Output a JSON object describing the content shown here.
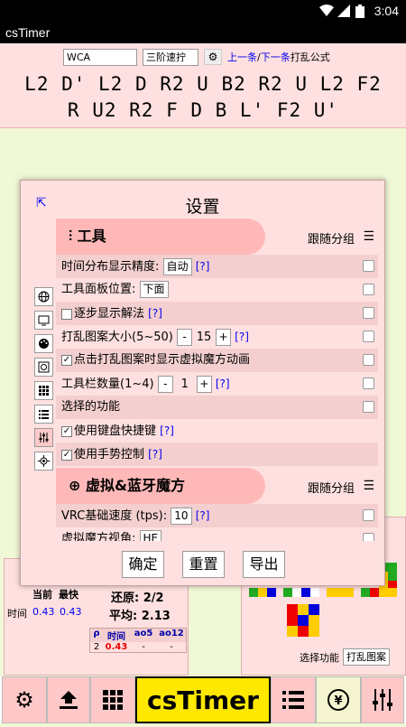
{
  "status_bar": {
    "time": "3:04"
  },
  "app_title": "csTimer",
  "scramble_bar": {
    "event_type": "WCA",
    "event": "三阶速拧",
    "prev_link": "上一条",
    "separator": "/",
    "next_link": "下一条",
    "scramble_label": "打乱公式",
    "scramble_line1": "L2 D' L2 D R2 U B2 R2 U L2 F2",
    "scramble_line2": "R U2 R2 F D B L' F2 U'"
  },
  "dialog": {
    "title": "设置",
    "sections": [
      {
        "name": "工具",
        "follow": "跟随分组"
      },
      {
        "name": "虚拟&蓝牙魔方",
        "follow": "跟随分组"
      }
    ],
    "options": {
      "time_precision_label": "时间分布显示精度:",
      "time_precision_value": "自动",
      "panel_position_label": "工具面板位置:",
      "panel_position_value": "下面",
      "step_solution_label": "逐步显示解法",
      "scramble_size_label": "打乱图案大小(5~50)",
      "scramble_size_value": "15",
      "click_animation_label": "点击打乱图案时显示虚拟魔方动画",
      "toolbar_count_label": "工具栏数量(1~4)",
      "toolbar_count_value": "1",
      "selected_functions_label": "选择的功能",
      "keyboard_shortcut_label": "使用键盘快捷键",
      "gesture_label": "使用手势控制",
      "vrc_speed_label": "VRC基础速度 (tps):",
      "vrc_speed_value": "10",
      "vrc_view_label": "虚拟魔方视角:",
      "vrc_view_value": "HE"
    },
    "help": "[?]",
    "minus": "-",
    "plus": "+",
    "buttons": {
      "ok": "确定",
      "reset": "重置",
      "export": "导出"
    }
  },
  "stats": {
    "current": "当前",
    "best": "最快",
    "time_label": "时间",
    "current_time": "0.43",
    "best_time": "0.43",
    "solved": "还原: 2/2",
    "mean": "平均: 2.13",
    "table_headers": [
      "ρ",
      "时间",
      "ao5",
      "ao12"
    ],
    "table_row": [
      "2",
      "0.43",
      "-",
      "-"
    ]
  },
  "tool_panel": {
    "select_label": "选择功能",
    "select_value": "打乱图案"
  },
  "toolbar": {
    "logo": "csTimer"
  },
  "colors": {
    "accent_pink": "#ffb8b8",
    "panel_bg": "#ffe0e0",
    "logo_bg": "#ffe800"
  }
}
